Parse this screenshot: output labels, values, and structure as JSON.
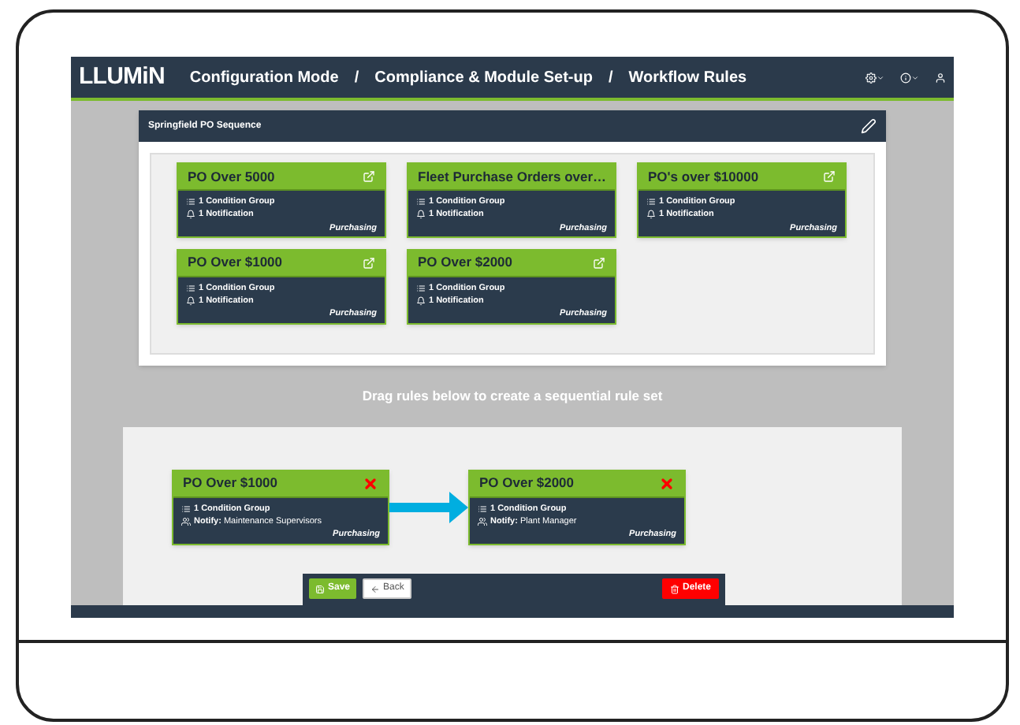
{
  "header": {
    "logo": "LLUMiN",
    "breadcrumbs": [
      "Configuration Mode",
      "/",
      "Compliance & Module Set-up",
      "/",
      "Workflow Rules"
    ]
  },
  "panel": {
    "title": "Springfield PO Sequence"
  },
  "rules": [
    {
      "title": "PO Over 5000",
      "conditions": "1 Condition Group",
      "notifications": "1 Notification",
      "category": "Purchasing"
    },
    {
      "title": "Fleet Purchase Orders over…",
      "conditions": "1 Condition Group",
      "notifications": "1 Notification",
      "category": "Purchasing"
    },
    {
      "title": "PO's over $10000",
      "conditions": "1 Condition Group",
      "notifications": "1 Notification",
      "category": "Purchasing"
    },
    {
      "title": "PO Over $1000",
      "conditions": "1 Condition Group",
      "notifications": "1 Notification",
      "category": "Purchasing"
    },
    {
      "title": "PO Over $2000",
      "conditions": "1 Condition Group",
      "notifications": "1 Notification",
      "category": "Purchasing"
    }
  ],
  "drag_hint": "Drag rules below to create a sequential rule set",
  "sequence": [
    {
      "title": "PO Over $1000",
      "conditions": "1 Condition Group",
      "notify_label": "Notify:",
      "notify_value": "Maintenance Supervisors",
      "category": "Purchasing"
    },
    {
      "title": "PO Over $2000",
      "conditions": "1 Condition Group",
      "notify_label": "Notify:",
      "notify_value": "Plant Manager",
      "category": "Purchasing"
    }
  ],
  "buttons": [
    {
      "label": "Save",
      "kind": "save"
    },
    {
      "label": "Back",
      "kind": "back"
    },
    {
      "label": "Delete",
      "kind": "delete"
    }
  ]
}
